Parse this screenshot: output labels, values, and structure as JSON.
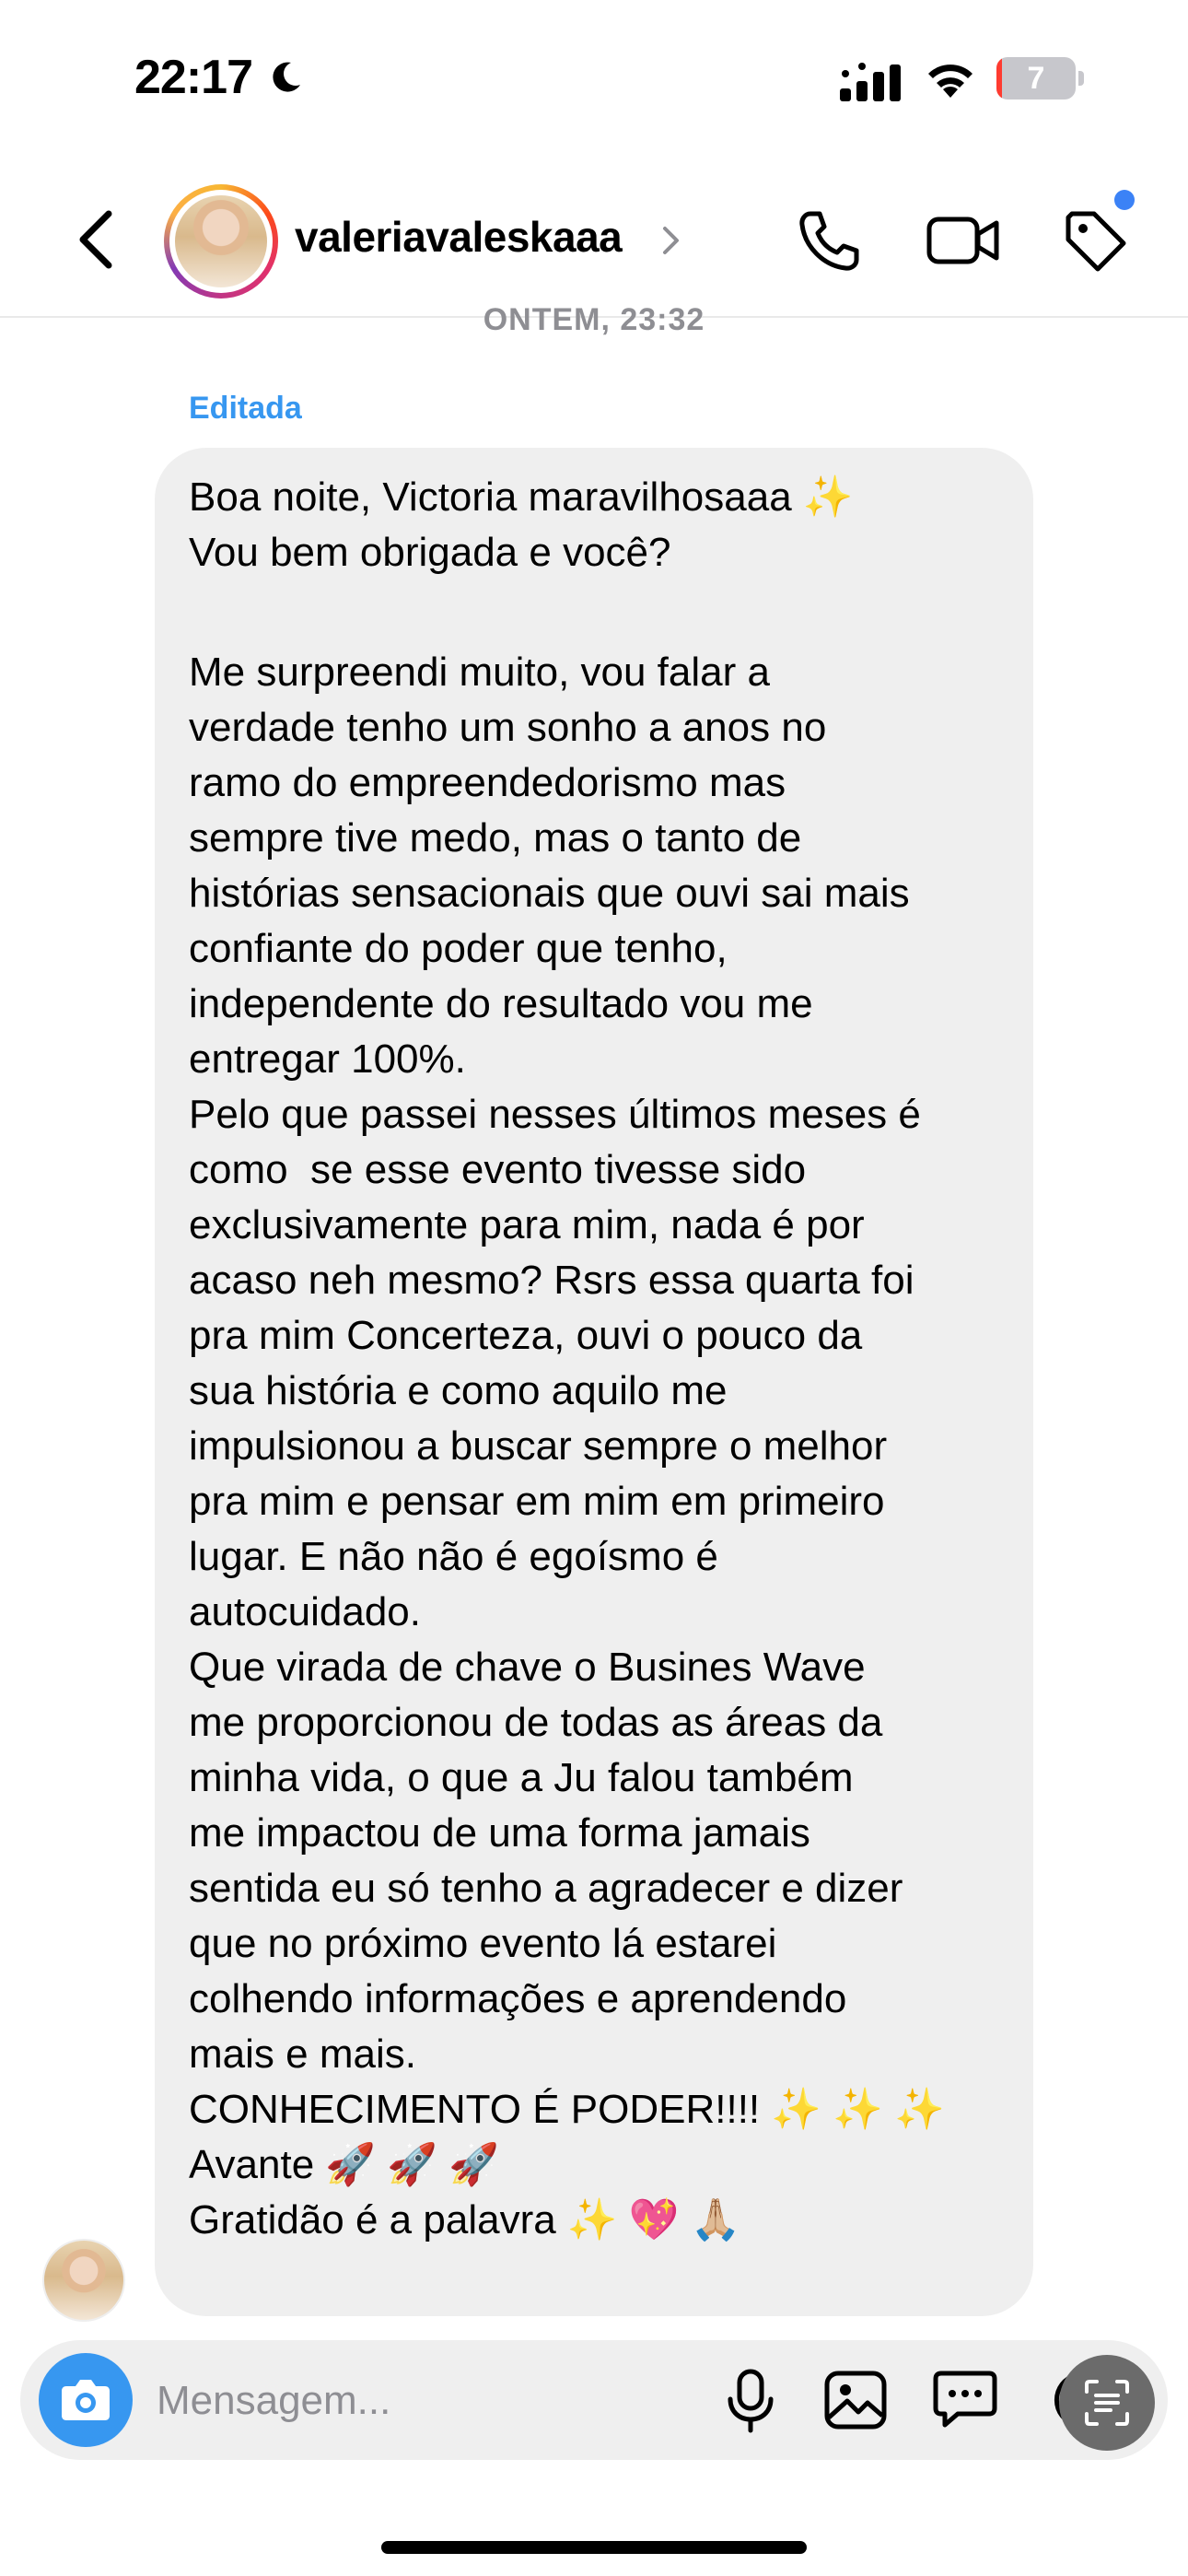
{
  "status_bar": {
    "time": "22:17",
    "battery_level": "7",
    "battery_fraction": 0.07,
    "icons": [
      "moon-icon",
      "cellular-signal-icon",
      "wifi-icon",
      "battery-icon"
    ]
  },
  "header": {
    "username": "valeriavaleskaaa",
    "icons": [
      "back-chevron-icon",
      "call-icon",
      "video-call-icon",
      "tag-icon"
    ],
    "accent_color": "#3b82f6"
  },
  "chat": {
    "timestamp": "ONTEM, 23:32",
    "edited_label": "Editada",
    "message_lines": [
      "Boa noite, Victoria maravilhosaaa ✨",
      "Vou bem obrigada e você?",
      "",
      "Me surpreendi muito, vou falar a",
      "verdade tenho um sonho a anos no",
      "ramo do empreendedorismo mas",
      "sempre tive medo, mas o tanto de",
      "histórias sensacionais que ouvi sai mais",
      "confiante do poder que tenho,",
      "independente do resultado vou me",
      "entregar 100%.",
      "Pelo que passei nesses últimos meses é",
      "como  se esse evento tivesse sido",
      "exclusivamente para mim, nada é por",
      "acaso neh mesmo? Rsrs essa quarta foi",
      "pra mim Concerteza, ouvi o pouco da",
      "sua história e como aquilo me",
      "impulsionou a buscar sempre o melhor",
      "pra mim e pensar em mim em primeiro",
      "lugar. E não não é egoísmo é",
      "autocuidado.",
      "Que virada de chave o Busines Wave",
      "me proporcionou de todas as áreas da",
      "minha vida, o que a Ju falou também",
      "me impactou de uma forma jamais",
      "sentida eu só tenho a agradecer e dizer",
      "que no próximo evento lá estarei",
      "colhendo informações e aprendendo",
      "mais e mais.",
      "CONHECIMENTO É PODER!!!! ✨ ✨ ✨",
      "Avante 🚀 🚀 🚀",
      "Gratidão é a palavra ✨ 💖 🙏🏼"
    ],
    "bubble_color": "#efefef",
    "edited_color": "#3797f0"
  },
  "composer": {
    "placeholder": "Mensagem...",
    "icons": [
      "camera-icon",
      "microphone-icon",
      "gallery-icon",
      "sticker-icon",
      "scan-text-icon"
    ],
    "camera_color": "#3797f0"
  }
}
